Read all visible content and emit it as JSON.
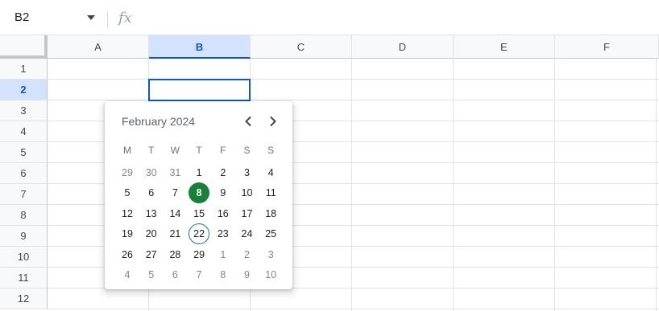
{
  "formula_bar": {
    "name_box": "B2",
    "fx_label": "fx"
  },
  "columns": [
    "A",
    "B",
    "C",
    "D",
    "E",
    "F"
  ],
  "selected_column": "B",
  "rows": [
    "1",
    "2",
    "3",
    "4",
    "5",
    "6",
    "7",
    "8",
    "9",
    "10",
    "11",
    "12"
  ],
  "selected_row": "2",
  "active_cell": "B2",
  "date_picker": {
    "month_label": "February 2024",
    "weekdays": [
      "M",
      "T",
      "W",
      "T",
      "F",
      "S",
      "S"
    ],
    "selected_day": "8",
    "today_day": "22",
    "weeks": [
      [
        {
          "d": "29",
          "muted": true
        },
        {
          "d": "30",
          "muted": true
        },
        {
          "d": "31",
          "muted": true
        },
        {
          "d": "1"
        },
        {
          "d": "2"
        },
        {
          "d": "3"
        },
        {
          "d": "4"
        }
      ],
      [
        {
          "d": "5"
        },
        {
          "d": "6"
        },
        {
          "d": "7"
        },
        {
          "d": "8",
          "selected": true
        },
        {
          "d": "9"
        },
        {
          "d": "10"
        },
        {
          "d": "11"
        }
      ],
      [
        {
          "d": "12"
        },
        {
          "d": "13"
        },
        {
          "d": "14"
        },
        {
          "d": "15"
        },
        {
          "d": "16"
        },
        {
          "d": "17"
        },
        {
          "d": "18"
        }
      ],
      [
        {
          "d": "19"
        },
        {
          "d": "20"
        },
        {
          "d": "21"
        },
        {
          "d": "22",
          "today": true
        },
        {
          "d": "23"
        },
        {
          "d": "24"
        },
        {
          "d": "25"
        }
      ],
      [
        {
          "d": "26"
        },
        {
          "d": "27"
        },
        {
          "d": "28"
        },
        {
          "d": "29"
        },
        {
          "d": "1",
          "muted": true
        },
        {
          "d": "2",
          "muted": true
        },
        {
          "d": "3",
          "muted": true
        }
      ],
      [
        {
          "d": "4",
          "muted": true
        },
        {
          "d": "5",
          "muted": true
        },
        {
          "d": "6",
          "muted": true
        },
        {
          "d": "7",
          "muted": true
        },
        {
          "d": "8",
          "muted": true
        },
        {
          "d": "9",
          "muted": true
        },
        {
          "d": "10",
          "muted": true
        }
      ]
    ]
  },
  "colors": {
    "selection_blue": "#0b57d0",
    "selected_header_bg": "#d3e3fd",
    "selected_day_green": "#188038"
  }
}
